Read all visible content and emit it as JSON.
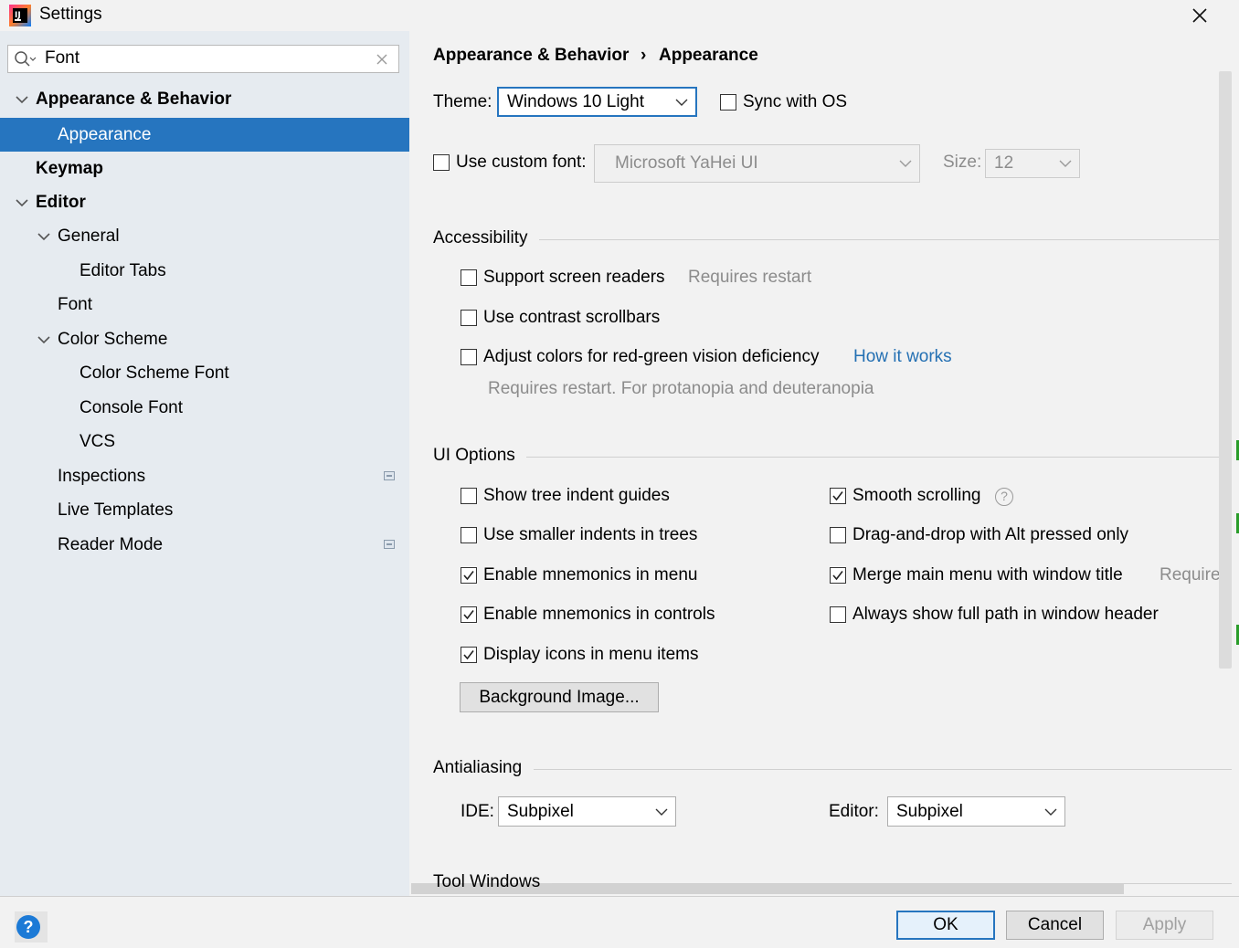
{
  "window": {
    "title": "Settings"
  },
  "search": {
    "value": "Font"
  },
  "tree": {
    "appearance_behavior": "Appearance & Behavior",
    "appearance": "Appearance",
    "keymap": "Keymap",
    "editor": "Editor",
    "general": "General",
    "editor_tabs": "Editor Tabs",
    "font": "Font",
    "color_scheme": "Color Scheme",
    "color_scheme_font": "Color Scheme Font",
    "console_font": "Console Font",
    "vcs": "VCS",
    "inspections": "Inspections",
    "live_templates": "Live Templates",
    "reader_mode": "Reader Mode"
  },
  "breadcrumb": {
    "parent": "Appearance & Behavior",
    "separator": "›",
    "current": "Appearance"
  },
  "theme": {
    "label": "Theme:",
    "value": "Windows 10 Light",
    "sync_label": "Sync with OS",
    "sync_checked": false
  },
  "custom_font": {
    "label": "Use custom font:",
    "checked": false,
    "font_value": "Microsoft YaHei UI",
    "size_label": "Size:",
    "size_value": "12"
  },
  "accessibility": {
    "title": "Accessibility",
    "screen_readers": "Support screen readers",
    "screen_readers_hint": "Requires restart",
    "contrast_scrollbars": "Use contrast scrollbars",
    "red_green": "Adjust colors for red-green vision deficiency",
    "how_it_works": "How it works",
    "red_green_hint": "Requires restart. For protanopia and deuteranopia"
  },
  "ui_options": {
    "title": "UI Options",
    "tree_indent": "Show tree indent guides",
    "smaller_indents": "Use smaller indents in trees",
    "mnemonics_menu": "Enable mnemonics in menu",
    "mnemonics_controls": "Enable mnemonics in controls",
    "icons_menu": "Display icons in menu items",
    "smooth_scrolling": "Smooth scrolling",
    "drag_drop": "Drag-and-drop with Alt pressed only",
    "merge_menu": "Merge main menu with window title",
    "merge_menu_hint": "Requires",
    "full_path": "Always show full path in window header",
    "background_image": "Background Image..."
  },
  "antialiasing": {
    "title": "Antialiasing",
    "ide_label": "IDE:",
    "ide_value": "Subpixel",
    "editor_label": "Editor:",
    "editor_value": "Subpixel"
  },
  "tool_windows": {
    "title": "Tool Windows"
  },
  "buttons": {
    "ok": "OK",
    "cancel": "Cancel",
    "apply": "Apply",
    "help": "?"
  },
  "colors": {
    "selection": "#2675bf",
    "sidebar_bg": "#e6ebf0",
    "link": "#2470b3",
    "hint": "#8c8c8c"
  }
}
